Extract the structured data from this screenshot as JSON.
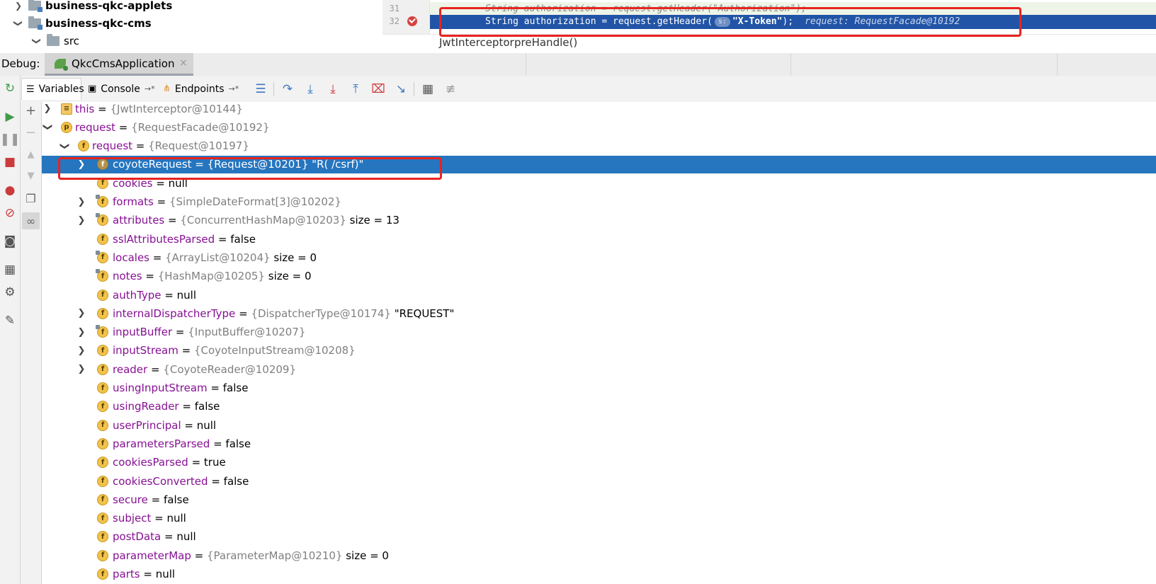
{
  "project_tree": {
    "items": [
      {
        "label": "business-qkc-applets",
        "expanded": false,
        "bold": true
      },
      {
        "label": "business-qkc-cms",
        "expanded": true,
        "bold": true
      },
      {
        "label": "src",
        "expanded": true,
        "bold": false
      }
    ]
  },
  "editor": {
    "lines": [
      {
        "number": "31",
        "text": "String authorization = request.getHeader(\"Authorization\");"
      },
      {
        "number": "32",
        "text_before": "String authorization = request.getHeader(",
        "param_hint": "s:",
        "text_string": "\"X-Token\"",
        "text_after": ");",
        "inline_value": "request: RequestFacade@10192"
      }
    ],
    "breadcrumb": [
      "JwtInterceptor",
      "preHandle()"
    ],
    "breadcrumb_sep": "›"
  },
  "debug_header": {
    "label": "Debug:",
    "session": "QkcCmsApplication",
    "close_glyph": "×"
  },
  "toolbar": {
    "tabs": [
      {
        "label": "Variables",
        "active": true
      },
      {
        "label": "Console",
        "active": false,
        "pin": "→*"
      },
      {
        "label": "Endpoints",
        "active": false,
        "pin": "→*"
      }
    ]
  },
  "icons": {
    "rerun": "rerun-icon",
    "resume": "resume-icon",
    "pause": "pause-icon",
    "stop": "stop-icon",
    "view_breakpoints": "view-breakpoints-icon",
    "mute_breakpoints": "mute-breakpoints-icon",
    "camera": "camera-icon",
    "layout": "layout-icon",
    "settings": "settings-icon",
    "pin": "pin-icon",
    "step_over": "step-over-icon",
    "step_into": "step-into-icon",
    "force_step_into": "force-step-into-icon",
    "step_out": "step-out-icon",
    "drop_frame": "drop-frame-icon",
    "run_to_cursor": "run-to-cursor-icon",
    "evaluate": "evaluate-icon",
    "trace": "trace-icon"
  },
  "variables": [
    {
      "indent": 0,
      "expand": "collapsed",
      "icon": "lines",
      "name": "this",
      "eq": " = ",
      "type": "{JwtInterceptor@10144}",
      "value": "",
      "extra": ""
    },
    {
      "indent": 0,
      "expand": "expanded",
      "icon": "p",
      "name": "request",
      "eq": " = ",
      "type": "{RequestFacade@10192}",
      "value": "",
      "extra": ""
    },
    {
      "indent": 1,
      "expand": "expanded",
      "icon": "f",
      "name": "request",
      "eq": " = ",
      "type": "{Request@10197}",
      "value": "",
      "extra": ""
    },
    {
      "indent": 2,
      "expand": "collapsed",
      "icon": "f",
      "name": "coyoteRequest",
      "eq": " = ",
      "type": "{Request@10201}",
      "value": " \"R( /csrf)\"",
      "extra": "",
      "selected": true
    },
    {
      "indent": 2,
      "expand": "none",
      "icon": "f",
      "name": "cookies",
      "eq": " = ",
      "type": "",
      "value": "null",
      "extra": ""
    },
    {
      "indent": 2,
      "expand": "collapsed",
      "icon": "f-locked",
      "name": "formats",
      "eq": " = ",
      "type": "{SimpleDateFormat[3]@10202}",
      "value": "",
      "extra": ""
    },
    {
      "indent": 2,
      "expand": "collapsed",
      "icon": "f-locked",
      "name": "attributes",
      "eq": " = ",
      "type": "{ConcurrentHashMap@10203}",
      "value": "",
      "extra": "  size = 13"
    },
    {
      "indent": 2,
      "expand": "none",
      "icon": "f",
      "name": "sslAttributesParsed",
      "eq": " = ",
      "type": "",
      "value": "false",
      "extra": ""
    },
    {
      "indent": 2,
      "expand": "none",
      "icon": "f-locked",
      "name": "locales",
      "eq": " = ",
      "type": "{ArrayList@10204}",
      "value": "",
      "extra": "  size = 0"
    },
    {
      "indent": 2,
      "expand": "none",
      "icon": "f-locked",
      "name": "notes",
      "eq": " = ",
      "type": "{HashMap@10205}",
      "value": "",
      "extra": "  size = 0"
    },
    {
      "indent": 2,
      "expand": "none",
      "icon": "f",
      "name": "authType",
      "eq": " = ",
      "type": "",
      "value": "null",
      "extra": ""
    },
    {
      "indent": 2,
      "expand": "collapsed",
      "icon": "f",
      "name": "internalDispatcherType",
      "eq": " = ",
      "type": "{DispatcherType@10174}",
      "value": " \"REQUEST\"",
      "extra": ""
    },
    {
      "indent": 2,
      "expand": "collapsed",
      "icon": "f-locked",
      "name": "inputBuffer",
      "eq": " = ",
      "type": "{InputBuffer@10207}",
      "value": "",
      "extra": ""
    },
    {
      "indent": 2,
      "expand": "collapsed",
      "icon": "f",
      "name": "inputStream",
      "eq": " = ",
      "type": "{CoyoteInputStream@10208}",
      "value": "",
      "extra": ""
    },
    {
      "indent": 2,
      "expand": "collapsed",
      "icon": "f",
      "name": "reader",
      "eq": " = ",
      "type": "{CoyoteReader@10209}",
      "value": "",
      "extra": ""
    },
    {
      "indent": 2,
      "expand": "none",
      "icon": "f",
      "name": "usingInputStream",
      "eq": " = ",
      "type": "",
      "value": "false",
      "extra": ""
    },
    {
      "indent": 2,
      "expand": "none",
      "icon": "f",
      "name": "usingReader",
      "eq": " = ",
      "type": "",
      "value": "false",
      "extra": ""
    },
    {
      "indent": 2,
      "expand": "none",
      "icon": "f",
      "name": "userPrincipal",
      "eq": " = ",
      "type": "",
      "value": "null",
      "extra": ""
    },
    {
      "indent": 2,
      "expand": "none",
      "icon": "f",
      "name": "parametersParsed",
      "eq": " = ",
      "type": "",
      "value": "false",
      "extra": ""
    },
    {
      "indent": 2,
      "expand": "none",
      "icon": "f",
      "name": "cookiesParsed",
      "eq": " = ",
      "type": "",
      "value": "true",
      "extra": ""
    },
    {
      "indent": 2,
      "expand": "none",
      "icon": "f",
      "name": "cookiesConverted",
      "eq": " = ",
      "type": "",
      "value": "false",
      "extra": ""
    },
    {
      "indent": 2,
      "expand": "none",
      "icon": "f",
      "name": "secure",
      "eq": " = ",
      "type": "",
      "value": "false",
      "extra": ""
    },
    {
      "indent": 2,
      "expand": "none",
      "icon": "f",
      "name": "subject",
      "eq": " = ",
      "type": "",
      "value": "null",
      "extra": ""
    },
    {
      "indent": 2,
      "expand": "none",
      "icon": "f",
      "name": "postData",
      "eq": " = ",
      "type": "",
      "value": "null",
      "extra": ""
    },
    {
      "indent": 2,
      "expand": "none",
      "icon": "f",
      "name": "parameterMap",
      "eq": " = ",
      "type": "{ParameterMap@10210}",
      "value": "",
      "extra": "  size = 0"
    },
    {
      "indent": 2,
      "expand": "none",
      "icon": "f",
      "name": "parts",
      "eq": " = ",
      "type": "",
      "value": "null",
      "extra": ""
    }
  ],
  "colors": {
    "selection": "#2675bf",
    "highlight_box": "#e8231f",
    "field_name": "#871094",
    "type_text": "#808080",
    "execution_line": "#2154a6"
  }
}
